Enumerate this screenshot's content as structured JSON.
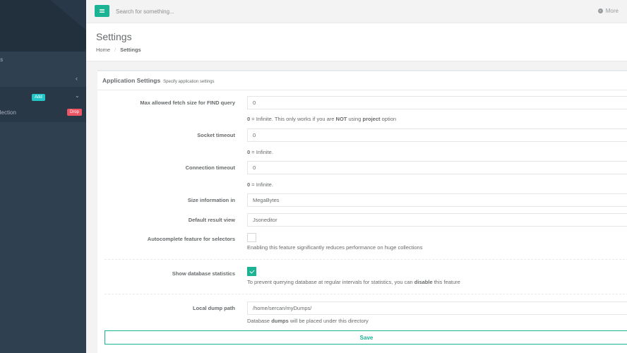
{
  "topbar": {
    "search_placeholder": "Search for something...",
    "more_label": "More"
  },
  "sidebar": {
    "item_a": "ts",
    "item_c": "llection",
    "add_label": "Add",
    "drop_label": "Drop"
  },
  "heading": {
    "title": "Settings",
    "breadcrumb_home": "Home",
    "breadcrumb_sep": "/",
    "breadcrumb_current": "Settings"
  },
  "panel": {
    "title": "Application Settings",
    "subtitle": "Specify application settings"
  },
  "fields": {
    "max_fetch": {
      "label": "Max allowed fetch size for FIND query",
      "value": "0",
      "help_a": "0",
      "help_b": " = Infinite. This only works if you are ",
      "help_c": "NOT",
      "help_d": " using ",
      "help_e": "project",
      "help_f": " option"
    },
    "socket_timeout": {
      "label": "Socket timeout",
      "value": "0",
      "help_a": "0",
      "help_b": " = Infinite."
    },
    "connection_timeout": {
      "label": "Connection timeout",
      "value": "0",
      "help_a": "0",
      "help_b": " = Infinite."
    },
    "size_info": {
      "label": "Size information in",
      "value": "MegaBytes"
    },
    "result_view": {
      "label": "Default result view",
      "value": "Jsoneditor"
    },
    "autocomplete": {
      "label": "Autocomplete feature for selectors",
      "checked": false,
      "help": "Enabling this feature significantly reduces performance on huge collections"
    },
    "db_stats": {
      "label": "Show database statistics",
      "checked": true,
      "help_a": "To prevent querying database at regular intervals for statistics, you can ",
      "help_b": "disable",
      "help_c": " this feature"
    },
    "dump_path": {
      "label": "Local dump path",
      "value": "/home/sercan/myDumps/",
      "help_a": "Database ",
      "help_b": "dumps",
      "help_c": " will be placed under this directory"
    }
  },
  "save_label": "Save",
  "colors": {
    "accent": "#1ab394",
    "sidebar": "#2f4050",
    "add_badge": "#23c6c8",
    "drop_badge": "#ed5565"
  }
}
